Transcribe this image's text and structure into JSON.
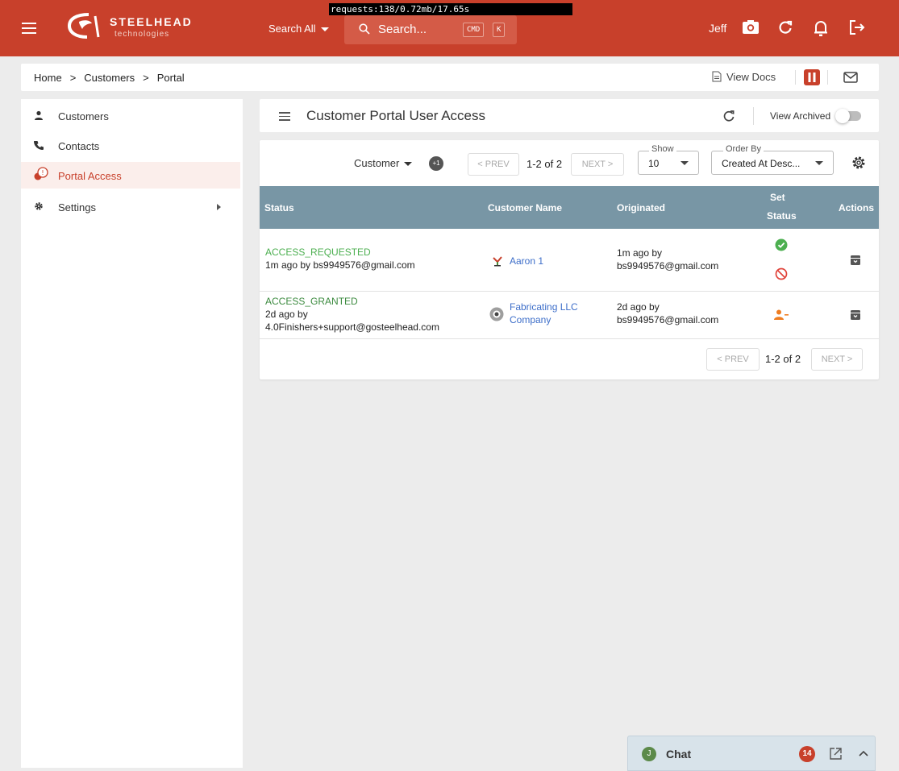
{
  "debug_bar": "requests:138/0.72mb/17.65s",
  "brand": {
    "name": "STEELHEAD",
    "sub": "technologies"
  },
  "topbar": {
    "search_scope": "Search All",
    "search_placeholder": "Search...",
    "kbd_cmd": "CMD",
    "kbd_k": "K",
    "user": "Jeff"
  },
  "breadcrumb": {
    "home": "Home",
    "customers": "Customers",
    "portal": "Portal",
    "sep": ">"
  },
  "view_docs": "View Docs",
  "sidebar": {
    "items": [
      {
        "label": "Customers",
        "icon": "person-icon"
      },
      {
        "label": "Contacts",
        "icon": "phone-icon"
      },
      {
        "label": "Portal Access",
        "icon": "globe-alert-icon",
        "active": true
      },
      {
        "label": "Settings",
        "icon": "gear-icon"
      }
    ]
  },
  "page": {
    "title": "Customer Portal User Access",
    "view_archived": "View Archived"
  },
  "filters": {
    "customer": "Customer",
    "badge": "+1",
    "prev": "< PREV",
    "count": "1-2 of 2",
    "next": "NEXT >",
    "show_label": "Show",
    "show_value": "10",
    "order_label": "Order By",
    "order_value": "Created At Desc..."
  },
  "table": {
    "headers": {
      "status": "Status",
      "customer": "Customer Name",
      "originated": "Originated",
      "set_status_1": "Set",
      "set_status_2": "Status",
      "actions": "Actions"
    },
    "rows": [
      {
        "status": "ACCESS_REQUESTED",
        "status_by": "1m ago by bs9949576@gmail.com",
        "customer": "Aaron 1",
        "orig_1": "1m ago by",
        "orig_2": "bs9949576@gmail.com"
      },
      {
        "status": "ACCESS_GRANTED",
        "status_by_1": "2d ago by",
        "status_by_2": "4.0Finishers+support@gosteelhead.com",
        "customer_1": "Fabricating LLC",
        "customer_2": "Company",
        "orig_1": "2d ago by",
        "orig_2": "bs9949576@gmail.com"
      }
    ]
  },
  "pager_bottom": {
    "prev": "< PREV",
    "count": "1-2 of 2",
    "next": "NEXT >"
  },
  "chat": {
    "avatar": "J",
    "title": "Chat",
    "unread": "14"
  },
  "colors": {
    "brand": "#c8402b",
    "header_row": "#7896a5",
    "status_green": "#4caf50",
    "link": "#3d6ec9"
  }
}
